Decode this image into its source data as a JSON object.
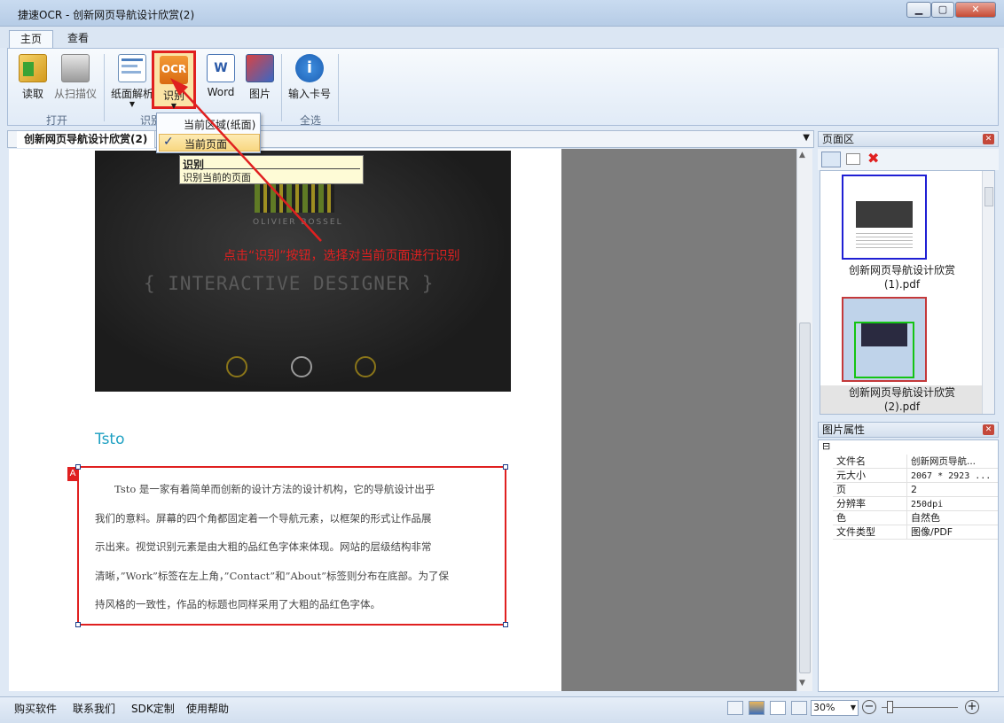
{
  "app": {
    "title": "捷速OCR - 创新网页导航设计欣赏(2)"
  },
  "tabs": [
    {
      "label": "主页"
    },
    {
      "label": "查看"
    }
  ],
  "ribbon": {
    "read": "读取",
    "scan": "从扫描仪",
    "parse": "纸面解析",
    "recognize": "识别",
    "word": "Word",
    "image": "图片",
    "serial": "输入卡号",
    "group_open": "打开",
    "group_recog": "识别",
    "group_all": "全选"
  },
  "dropdown": {
    "item1": "当前区域(纸面)",
    "item2": "当前页面",
    "check": "✓"
  },
  "tooltip": {
    "title": "识别",
    "desc": "识别当前的页面"
  },
  "annotation": "点击“识别”按钮，选择对当前页面进行识别",
  "doc_tab": "创新网页导航设计欣赏(2)",
  "doc": {
    "hero_text": "{ INTERACTIVE DESIGNER }",
    "logo_text": "OLIVIER BOSSEL",
    "section_title": "Tsto",
    "paragraph_lines": [
      "Tsto 是一家有着简单而创新的设计方法的设计机构，它的导航设计出乎",
      "我们的意料。屏幕的四个角都固定着一个导航元素，以框架的形式让作品展",
      "示出来。视觉识别元素是由大粗的品红色字体来体现。网站的层级结构非常",
      "清晰，”Work”标签在左上角，”Contact”和”About”标签则分布在底部。为了保",
      "持风格的一致性，作品的标题也同样采用了大粗的品红色字体。"
    ],
    "region_badge": "A"
  },
  "pages_panel": {
    "title": "页面区",
    "thumb1_line1": "创新网页导航设计欣赏",
    "thumb1_line2": "(1).pdf",
    "thumb2_line1": "创新网页导航设计欣赏",
    "thumb2_line2": "(2).pdf"
  },
  "props_panel": {
    "title": "图片属性",
    "collapse": "⊟",
    "rows": [
      {
        "k": "文件名",
        "v": "创新网页导航..."
      },
      {
        "k": "元大小",
        "v": "2067 * 2923 ..."
      },
      {
        "k": "页",
        "v": "2"
      },
      {
        "k": "分辨率",
        "v": "250dpi"
      },
      {
        "k": "色",
        "v": "自然色"
      },
      {
        "k": "文件类型",
        "v": "图像/PDF"
      }
    ]
  },
  "status": {
    "buy": "购买软件",
    "contact": "联系我们",
    "sdk": "SDK定制",
    "help": "使用帮助",
    "zoom": "30%"
  },
  "colors": {
    "accent_red": "#e02020",
    "teal": "#1ea0c2"
  }
}
